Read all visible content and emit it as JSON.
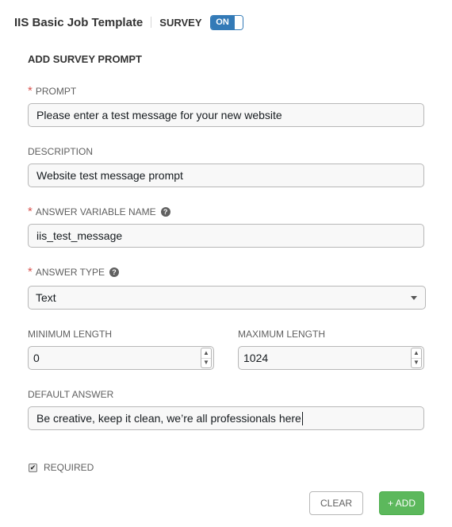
{
  "header": {
    "template_name": "IIS Basic Job Template",
    "survey_label": "SURVEY",
    "toggle_label": "ON"
  },
  "form": {
    "section_title": "ADD SURVEY PROMPT",
    "required_marker": "*",
    "help_glyph": "?",
    "prompt": {
      "label": "PROMPT",
      "value": "Please enter a test message for your new website"
    },
    "description": {
      "label": "DESCRIPTION",
      "value": "Website test message prompt"
    },
    "answer_variable": {
      "label": "ANSWER VARIABLE NAME",
      "value": "iis_test_message",
      "help_icon": "question-circle-icon"
    },
    "answer_type": {
      "label": "ANSWER TYPE",
      "value": "Text",
      "help_icon": "question-circle-icon"
    },
    "min_length": {
      "label": "MINIMUM LENGTH",
      "value": "0"
    },
    "max_length": {
      "label": "MAXIMUM LENGTH",
      "value": "1024"
    },
    "default_answer": {
      "label": "DEFAULT ANSWER",
      "value": "Be creative, keep it clean, we’re all professionals here"
    },
    "required": {
      "label": "REQUIRED",
      "checked": true
    }
  },
  "actions": {
    "clear_label": "CLEAR",
    "add_label": "+ ADD"
  },
  "colors": {
    "toggle_on": "#337ab7",
    "add_button": "#5cb85c",
    "required_star": "#d9534f"
  }
}
